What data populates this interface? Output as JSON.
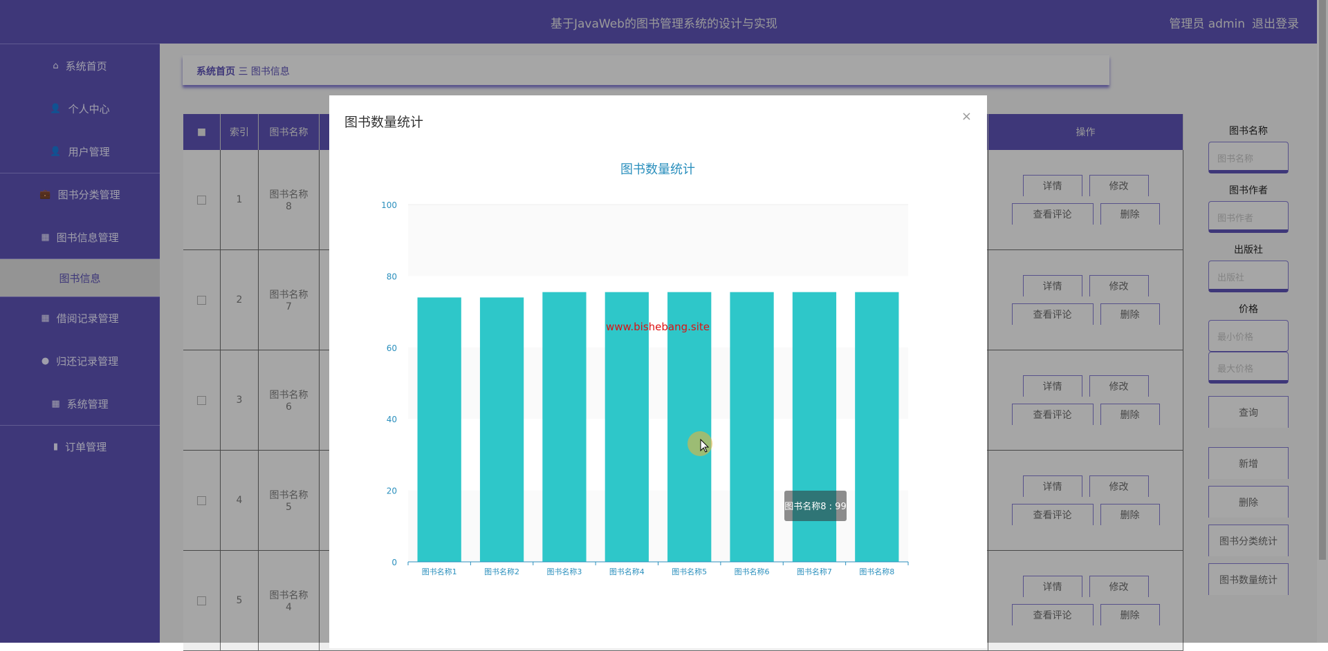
{
  "header": {
    "title": "基于JavaWeb的图书管理系统的设计与实现",
    "user": "管理员 admin",
    "logout": "退出登录"
  },
  "breadcrumb": {
    "home": "系统首页",
    "sep": "三",
    "current": "图书信息"
  },
  "sidebar": {
    "items": [
      {
        "label": "系统首页",
        "icon": "⌂"
      },
      {
        "label": "个人中心",
        "icon": "👤"
      },
      {
        "label": "用户管理",
        "icon": "👤"
      },
      {
        "label": "图书分类管理",
        "icon": "💼"
      },
      {
        "label": "图书信息管理",
        "icon": "▦"
      },
      {
        "label": "图书信息",
        "icon": ""
      },
      {
        "label": "借阅记录管理",
        "icon": "▦"
      },
      {
        "label": "归还记录管理",
        "icon": "●"
      },
      {
        "label": "系统管理",
        "icon": "▦"
      },
      {
        "label": "订单管理",
        "icon": "▮"
      }
    ]
  },
  "table": {
    "headers": {
      "index": "索引",
      "name": "图书名称",
      "op": "操作"
    },
    "rows": [
      {
        "index": "1",
        "name": "图书名称8"
      },
      {
        "index": "2",
        "name": "图书名称7"
      },
      {
        "index": "3",
        "name": "图书名称6"
      },
      {
        "index": "4",
        "name": "图书名称5"
      },
      {
        "index": "5",
        "name": "图书名称4"
      }
    ],
    "ops": {
      "detail": "详情",
      "edit": "修改",
      "comments": "查看评论",
      "delete": "删除"
    }
  },
  "search": {
    "name_label": "图书名称",
    "name_ph": "图书名称",
    "author_label": "图书作者",
    "author_ph": "图书作者",
    "publisher_label": "出版社",
    "publisher_ph": "出版社",
    "price_label": "价格",
    "min_ph": "最小价格",
    "max_ph": "最大价格",
    "query": "查询",
    "add": "新增",
    "delete": "删除",
    "cat_stats": "图书分类统计",
    "count_stats": "图书数量统计"
  },
  "modal": {
    "title": "图书数量统计",
    "close": "×",
    "watermark": "www.bishebang.site",
    "tooltip": "图书名称8 : 99"
  },
  "chart_data": {
    "type": "bar",
    "title": "图书数量统计",
    "categories": [
      "图书名称1",
      "图书名称2",
      "图书名称3",
      "图书名称4",
      "图书名称5",
      "图书名称6",
      "图书名称7",
      "图书名称8"
    ],
    "values": [
      74,
      74,
      75.5,
      75.5,
      75.5,
      75.5,
      75.5,
      75.5
    ],
    "ylim": [
      0,
      100
    ],
    "yticks": [
      0,
      20,
      40,
      60,
      80,
      100
    ],
    "color": "#2ec7c9",
    "xlabel": "",
    "ylabel": ""
  }
}
